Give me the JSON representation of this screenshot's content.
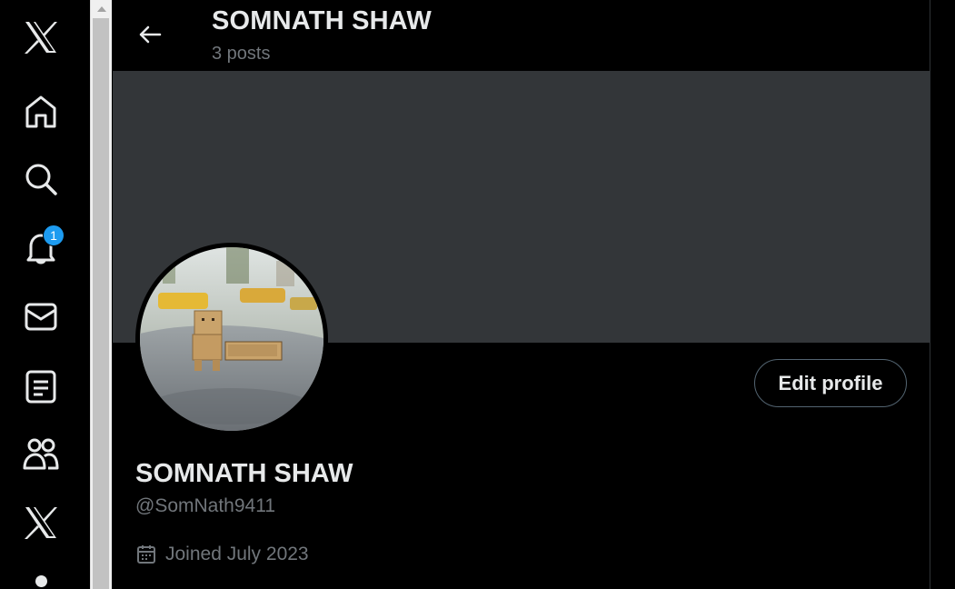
{
  "nav": {
    "items": [
      {
        "icon": "x-logo-icon"
      },
      {
        "icon": "home-icon"
      },
      {
        "icon": "search-icon"
      },
      {
        "icon": "bell-icon",
        "badge": "1"
      },
      {
        "icon": "mail-icon"
      },
      {
        "icon": "lists-icon"
      },
      {
        "icon": "communities-icon"
      },
      {
        "icon": "x-premium-icon"
      }
    ]
  },
  "header": {
    "title": "SOMNATH SHAW",
    "post_count": "3 posts"
  },
  "profile": {
    "name": "SOMNATH SHAW",
    "handle": "@SomNath9411",
    "joined": "Joined July 2023",
    "edit_label": "Edit profile"
  },
  "colors": {
    "background": "#000000",
    "banner": "#333639",
    "text_primary": "#e7e9ea",
    "text_secondary": "#71767b",
    "accent": "#1d9bf0"
  }
}
